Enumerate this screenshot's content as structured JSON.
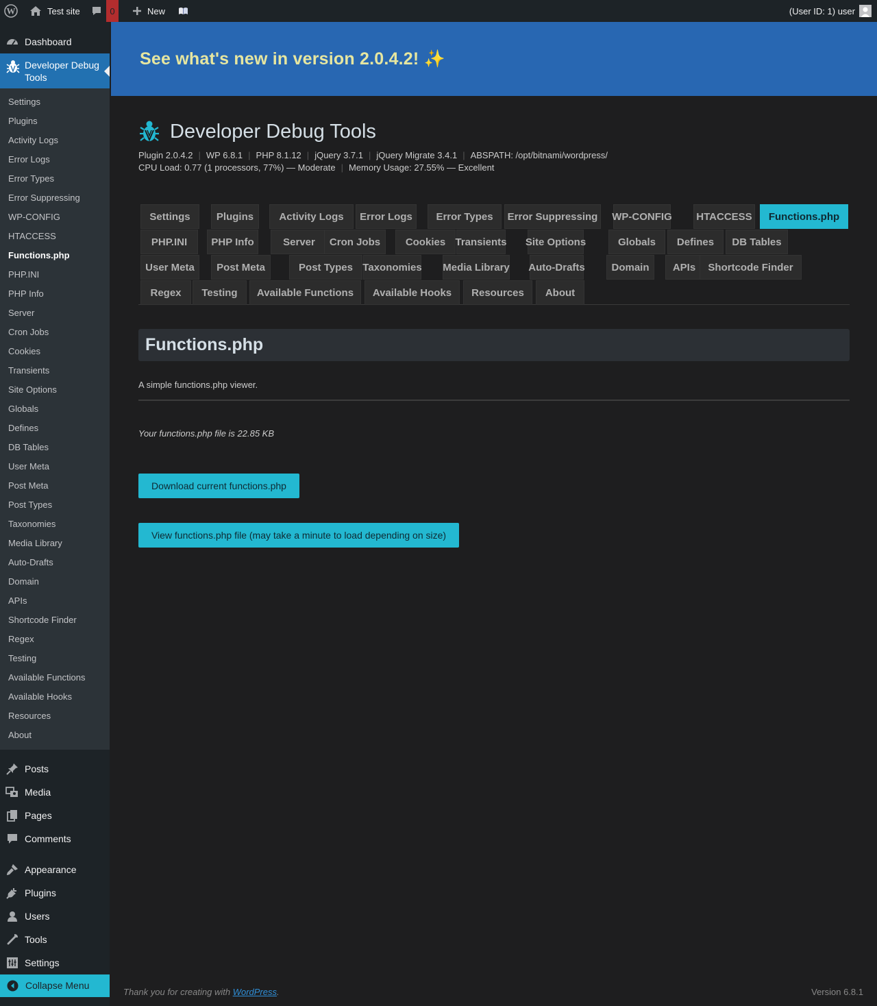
{
  "adminbar": {
    "site_name": "Test site",
    "comments_count": "0",
    "new_label": "New",
    "user_text": "(User ID: 1) user"
  },
  "sidebar": {
    "dashboard": "Dashboard",
    "ddt_label": "Developer Debug Tools",
    "submenu": [
      "Settings",
      "Plugins",
      "Activity Logs",
      "Error Logs",
      "Error Types",
      "Error Suppressing",
      "WP-CONFIG",
      "HTACCESS",
      "Functions.php",
      "PHP.INI",
      "PHP Info",
      "Server",
      "Cron Jobs",
      "Cookies",
      "Transients",
      "Site Options",
      "Globals",
      "Defines",
      "DB Tables",
      "User Meta",
      "Post Meta",
      "Post Types",
      "Taxonomies",
      "Media Library",
      "Auto-Drafts",
      "Domain",
      "APIs",
      "Shortcode Finder",
      "Regex",
      "Testing",
      "Available Functions",
      "Available Hooks",
      "Resources",
      "About"
    ],
    "current_submenu": "Functions.php",
    "posts": "Posts",
    "media": "Media",
    "pages": "Pages",
    "comments": "Comments",
    "appearance": "Appearance",
    "plugins": "Plugins",
    "users": "Users",
    "tools": "Tools",
    "settings": "Settings",
    "collapse": "Collapse Menu"
  },
  "banner": {
    "text": "See what's new in version 2.0.4.2! ✨"
  },
  "header": {
    "title": "Developer Debug Tools",
    "meta_line1": [
      "Plugin 2.0.4.2",
      "WP 6.8.1",
      "PHP 8.1.12",
      "jQuery 3.7.1",
      "jQuery Migrate 3.4.1",
      "ABSPATH: /opt/bitnami/wordpress/"
    ],
    "meta_line2": [
      "CPU Load: 0.77 (1 processors, 77%) — Moderate",
      "Memory Usage: 27.55% — Excellent"
    ]
  },
  "tabs": [
    "Settings",
    "Plugins",
    "Activity Logs",
    "Error Logs",
    "Error Types",
    "Error Suppressing",
    "WP-CONFIG",
    "HTACCESS",
    "Functions.php",
    "PHP.INI",
    "PHP Info",
    "Server",
    "Cron Jobs",
    "Cookies",
    "Transients",
    "Site Options",
    "Globals",
    "Defines",
    "DB Tables",
    "User Meta",
    "Post Meta",
    "Post Types",
    "Taxonomies",
    "Media Library",
    "Auto-Drafts",
    "Domain",
    "APIs",
    "Shortcode Finder",
    "Regex",
    "Testing",
    "Available Functions",
    "Available Hooks",
    "Resources",
    "About"
  ],
  "active_tab": "Functions.php",
  "section": {
    "title": "Functions.php",
    "description": "A simple functions.php viewer.",
    "filesize_text": "Your functions.php file is 22.85 KB",
    "download_button": "Download current functions.php",
    "view_button": "View functions.php file (may take a minute to load depending on size)"
  },
  "footer": {
    "thanks_prefix": "Thank you for creating with ",
    "thanks_link": "WordPress",
    "thanks_suffix": ".",
    "version": "Version 6.8.1"
  },
  "colors": {
    "accent": "#23b8d1",
    "banner": "#2867b2",
    "sidebar_bg": "#1d2327",
    "submenu_bg": "#2c3338",
    "active_menu": "#2271b1",
    "comment_badge": "#b32d2e"
  }
}
